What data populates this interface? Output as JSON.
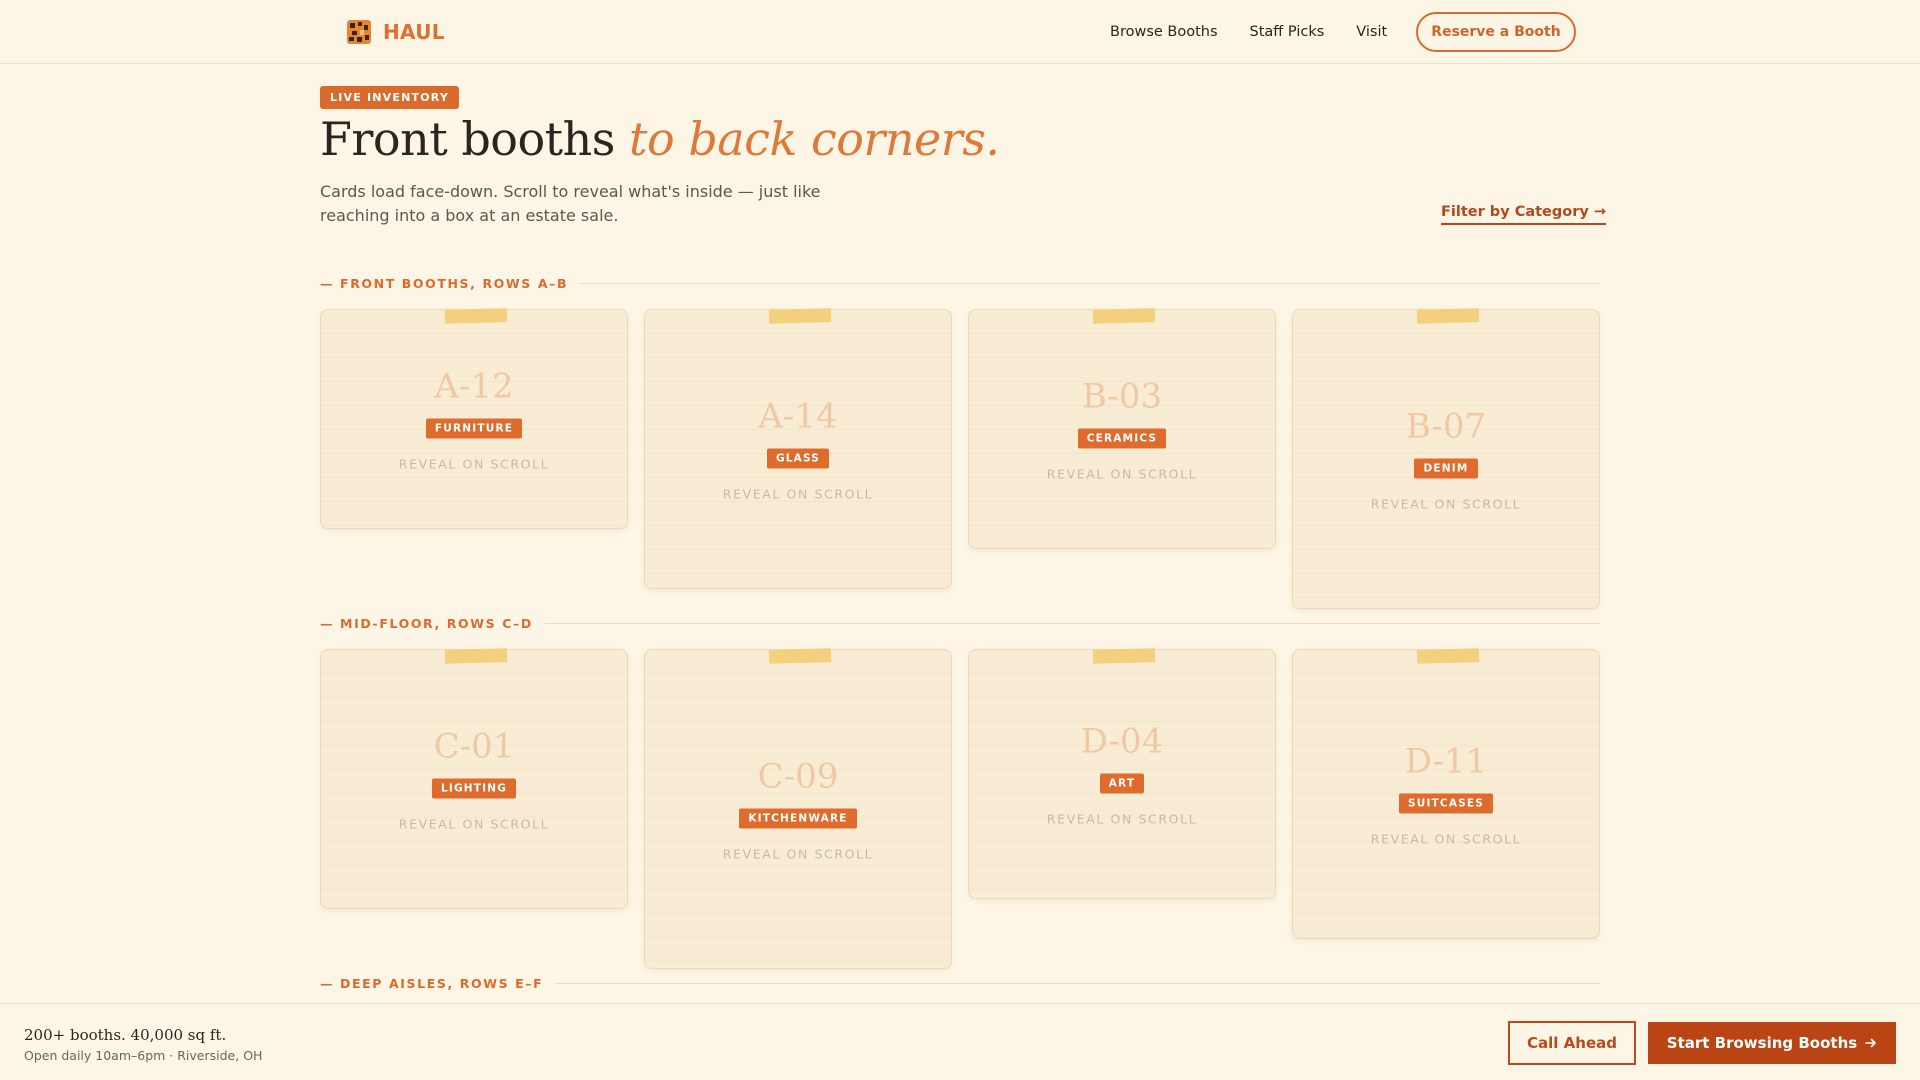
{
  "nav": {
    "brand": "HAUL",
    "links": [
      "Browse Booths",
      "Staff Picks",
      "Visit"
    ],
    "cta": "Reserve a Booth"
  },
  "hero": {
    "badge": "LIVE INVENTORY",
    "title_main": "Front booths ",
    "title_accent": "to back corners.",
    "subtitle": "Cards load face-down. Scroll to reveal what's inside — just like reaching into a box at an estate sale.",
    "filter_link": "Filter by Category →"
  },
  "sections": [
    {
      "label": "— FRONT BOOTHS, ROWS A–B",
      "booths": [
        {
          "id": "A-12",
          "category": "FURNITURE",
          "note": "REVEAL ON SCROLL"
        },
        {
          "id": "A-14",
          "category": "GLASS",
          "note": "REVEAL ON SCROLL"
        },
        {
          "id": "B-03",
          "category": "CERAMICS",
          "note": "REVEAL ON SCROLL"
        },
        {
          "id": "B-07",
          "category": "DENIM",
          "note": "REVEAL ON SCROLL"
        }
      ]
    },
    {
      "label": "— MID-FLOOR, ROWS C–D",
      "booths": [
        {
          "id": "C-01",
          "category": "LIGHTING",
          "note": "REVEAL ON SCROLL"
        },
        {
          "id": "C-09",
          "category": "KITCHENWARE",
          "note": "REVEAL ON SCROLL"
        },
        {
          "id": "D-04",
          "category": "ART",
          "note": "REVEAL ON SCROLL"
        },
        {
          "id": "D-11",
          "category": "SUITCASES",
          "note": "REVEAL ON SCROLL"
        }
      ]
    },
    {
      "label": "— DEEP AISLES, ROWS E–F",
      "booths": []
    }
  ],
  "bottom_bar": {
    "title": "200+ booths. 40,000 sq ft.",
    "subtitle": "Open daily 10am–6pm · Riverside, OH",
    "call_button": "Call Ahead",
    "start_button": "Start Browsing Booths",
    "start_icon": "arrow-right-icon"
  },
  "colors": {
    "background": "#fdf6e6",
    "accent": "#d96c2c",
    "accent_dark": "#b94414",
    "tape": "#f3cf79",
    "card": "#f9ecd5"
  }
}
